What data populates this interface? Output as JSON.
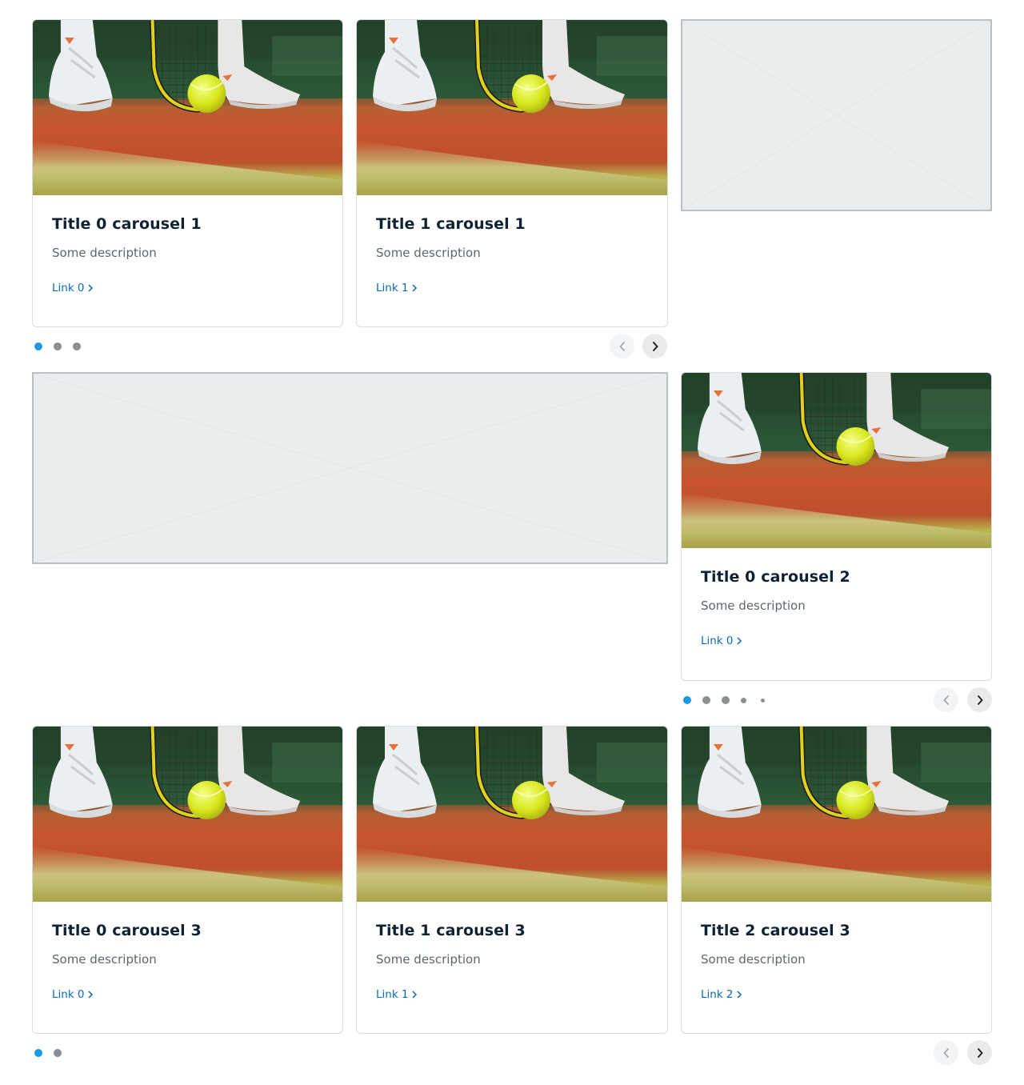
{
  "colors": {
    "accent": "#1b98e0",
    "link": "#0a69b8",
    "title": "#0f2233",
    "muted": "#5d666f",
    "placeholder_bg": "#e9edee"
  },
  "carousel1": {
    "cards": [
      {
        "title": "Title 0 carousel 1",
        "description": "Some description",
        "link": "Link 0"
      },
      {
        "title": "Title 1 carousel 1",
        "description": "Some description",
        "link": "Link 1"
      }
    ],
    "dot_count": 3,
    "active_dot": 1
  },
  "carousel2": {
    "cards": [
      {
        "title": "Title 0 carousel 2",
        "description": "Some description",
        "link": "Link 0"
      }
    ],
    "dot_count": 5,
    "active_dot": 1
  },
  "carousel3": {
    "cards": [
      {
        "title": "Title 0 carousel 3",
        "description": "Some description",
        "link": "Link 0"
      },
      {
        "title": "Title 1 carousel 3",
        "description": "Some description",
        "link": "Link 1"
      },
      {
        "title": "Title 2 carousel 3",
        "description": "Some description",
        "link": "Link 2"
      }
    ],
    "dot_count": 2,
    "active_dot": 1
  },
  "icons": {
    "prev": "chevron-left-icon",
    "next": "chevron-right-icon",
    "link_arrow": "chevron-right-small-icon"
  }
}
